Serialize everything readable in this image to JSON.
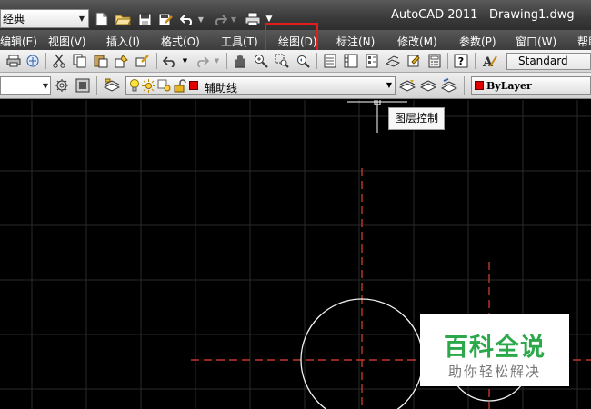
{
  "window": {
    "workspace": "经典",
    "app_title": "AutoCAD 2011",
    "doc_title": "Drawing1.dwg"
  },
  "menu": {
    "items": [
      "编辑(E)",
      "视图(V)",
      "插入(I)",
      "格式(O)",
      "工具(T)",
      "绘图(D)",
      "标注(N)",
      "修改(M)",
      "参数(P)",
      "窗口(W)",
      "帮助"
    ],
    "highlighted": "绘图(D)",
    "highlight_color": "#e01e1e"
  },
  "toolbar": {
    "text_style": "Standard"
  },
  "layers": {
    "current_layer": "辅助线",
    "layer_color": "#e00000",
    "linetype_color_label": "ByLayer",
    "tooltip": "图层控制"
  },
  "canvas": {
    "background": "#000000",
    "grid_color": "#2b2b2b",
    "centerline_color": "#c0392b",
    "circle_color": "#ffffff"
  },
  "watermark": {
    "main": "百科全说",
    "sub": "助你轻松解决",
    "color": "#2aa84a"
  }
}
